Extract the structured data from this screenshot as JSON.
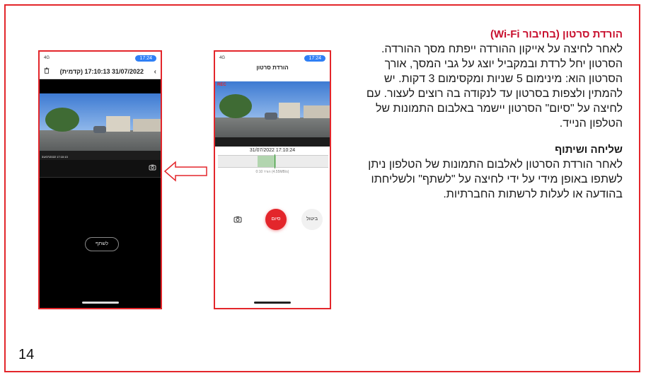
{
  "page": {
    "number": "14"
  },
  "section_download": {
    "title": "הורדת סרטון (בחיבור Wi-Fi)",
    "body": "לאחר לחיצה על אייקון ההורדה ייפתח מסך ההורדה. הסרטון יחל לרדת ובמקביל יוצג על גבי המסך, אורך הסרטון הוא: מינימום 5 שניות ומקסימום 3 דקות. יש להמתין ולצפות בסרטון עד לנקודה בה רוצים לעצור. עם לחיצה על \"סיום\" הסרטון יישמר באלבום התמונות של הטלפון הנייד."
  },
  "section_share": {
    "title": "שליחה ושיתוף",
    "body": "לאחר הורדת הסרטון לאלבום התמונות של הטלפון ניתן לשתפו באופן מידי על ידי לחיצה על \"לשתף\" ולשליחתו בהודעה או לעלות לרשתות החברתיות."
  },
  "phone_download": {
    "status_left": "4G",
    "time": "17:24",
    "title": "הורדת סרטון",
    "rec_label": "REC",
    "timestamp": "31/07/2022 17:10:24",
    "download_info": "(4.55MB/s) הורד 0:10",
    "end_button": "סיום",
    "cancel_button": "ביטול"
  },
  "phone_share": {
    "status_left": "4G",
    "time": "17:24",
    "title": "(קדמית) 31/07/2022 17:10:13",
    "overlay_text": "31/07/2022 17:10:13",
    "share_button": "לשתף"
  },
  "colors": {
    "accent": "#e3262b",
    "time_pill": "#2f7ff5"
  },
  "icons": [
    "camera-icon",
    "chevron-left-icon",
    "trash-icon",
    "arrow-left-icon"
  ]
}
